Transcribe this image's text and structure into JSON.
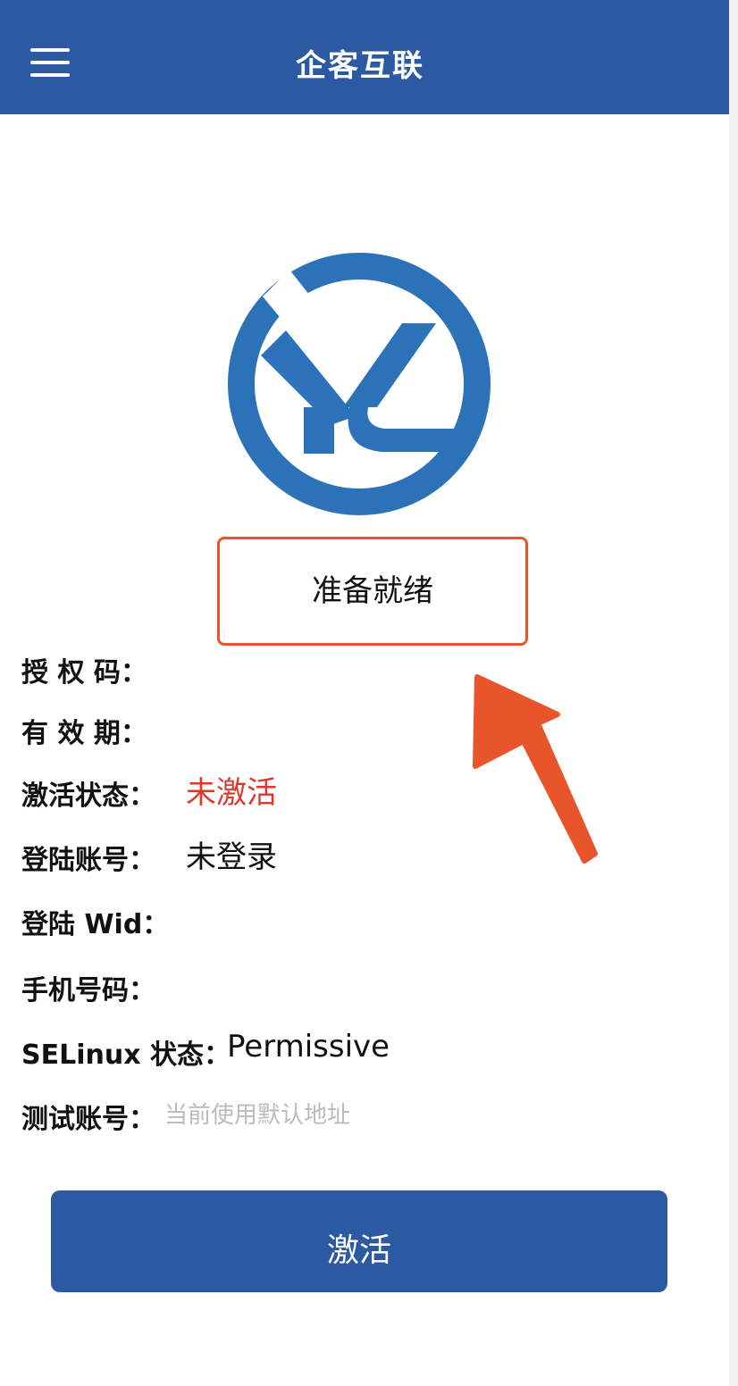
{
  "app_bar": {
    "title": "企客互联",
    "menu_icon": "hamburger-menu-icon"
  },
  "logo": {
    "text": "YC",
    "color": "#2c72b9"
  },
  "status": {
    "text": "准备就绪",
    "border_color": "#e8552b"
  },
  "annotation": {
    "arrow_color": "#e8552b"
  },
  "info": {
    "auth_code": {
      "label": "授 权 码：",
      "value": ""
    },
    "validity": {
      "label": "有 效 期：",
      "value": ""
    },
    "activation_status": {
      "label": "激活状态：",
      "value": "未激活",
      "value_color": "#d93a2b"
    },
    "login_account": {
      "label": "登陆账号：",
      "value": "未登录"
    },
    "login_wid": {
      "label": "登陆 Wid：",
      "value": ""
    },
    "phone": {
      "label": "手机号码：",
      "value": ""
    },
    "selinux": {
      "label": "SELinux 状态：",
      "value": "Permissive"
    },
    "test_account": {
      "label": "测试账号：",
      "placeholder": "当前使用默认地址"
    }
  },
  "activate_button": {
    "label": "激活"
  },
  "colors": {
    "primary": "#2b5aa2",
    "background": "#ffffff"
  }
}
